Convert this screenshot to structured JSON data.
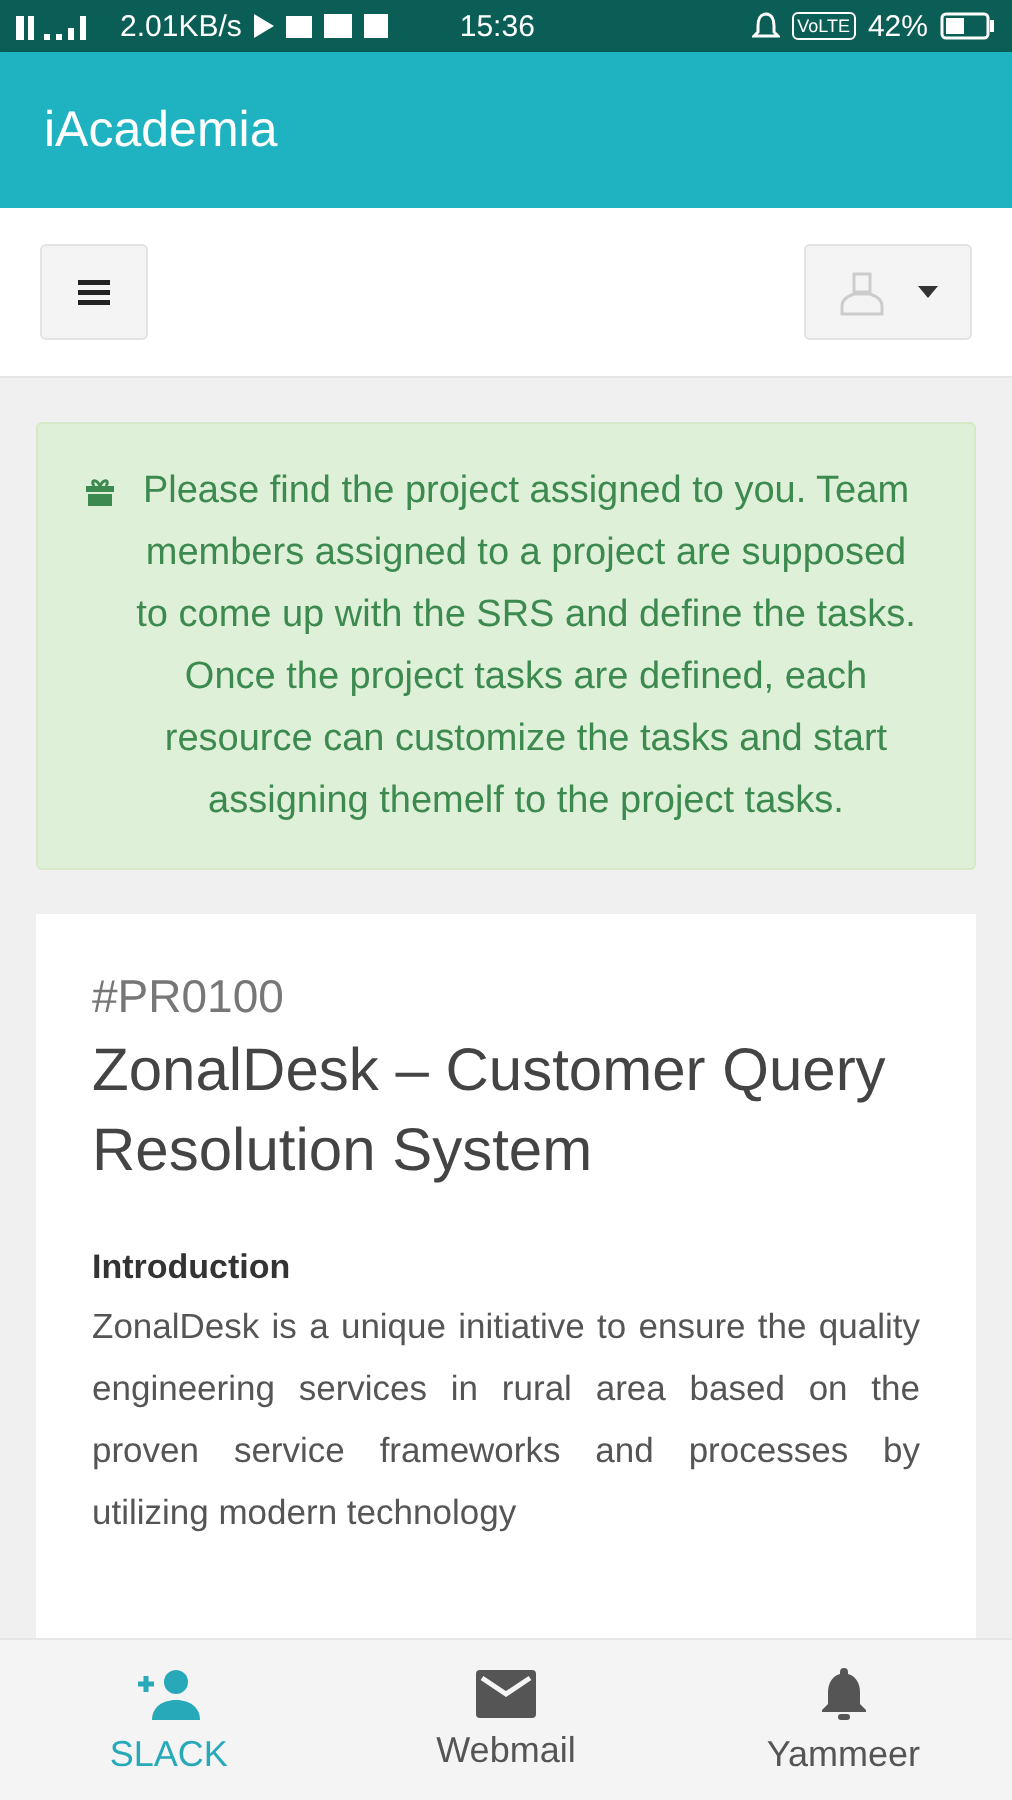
{
  "status_bar": {
    "speed": "2.01KB/s",
    "time": "15:36",
    "volte": "VoLTE",
    "battery": "42%"
  },
  "app_bar": {
    "title": "iAcademia"
  },
  "alert": {
    "text": "Please find the project assigned to you. Team members assigned to a project are supposed to come up with the SRS and define the tasks. Once the project tasks are defined, each resource can customize the tasks and start assigning themelf to the project tasks."
  },
  "project": {
    "code": "#PR0100",
    "title": "ZonalDesk – Customer Query Resolution System",
    "section": "Introduction",
    "body": "ZonalDesk is a unique initiative to ensure the quality engineering services in rural area based on the proven service frameworks and processes by utilizing modern technology"
  },
  "bottom_nav": [
    {
      "label": "SLACK",
      "kind": "person-add",
      "selected": true
    },
    {
      "label": "Webmail",
      "kind": "mail",
      "selected": false
    },
    {
      "label": "Yammeer",
      "kind": "bell",
      "selected": false
    }
  ]
}
